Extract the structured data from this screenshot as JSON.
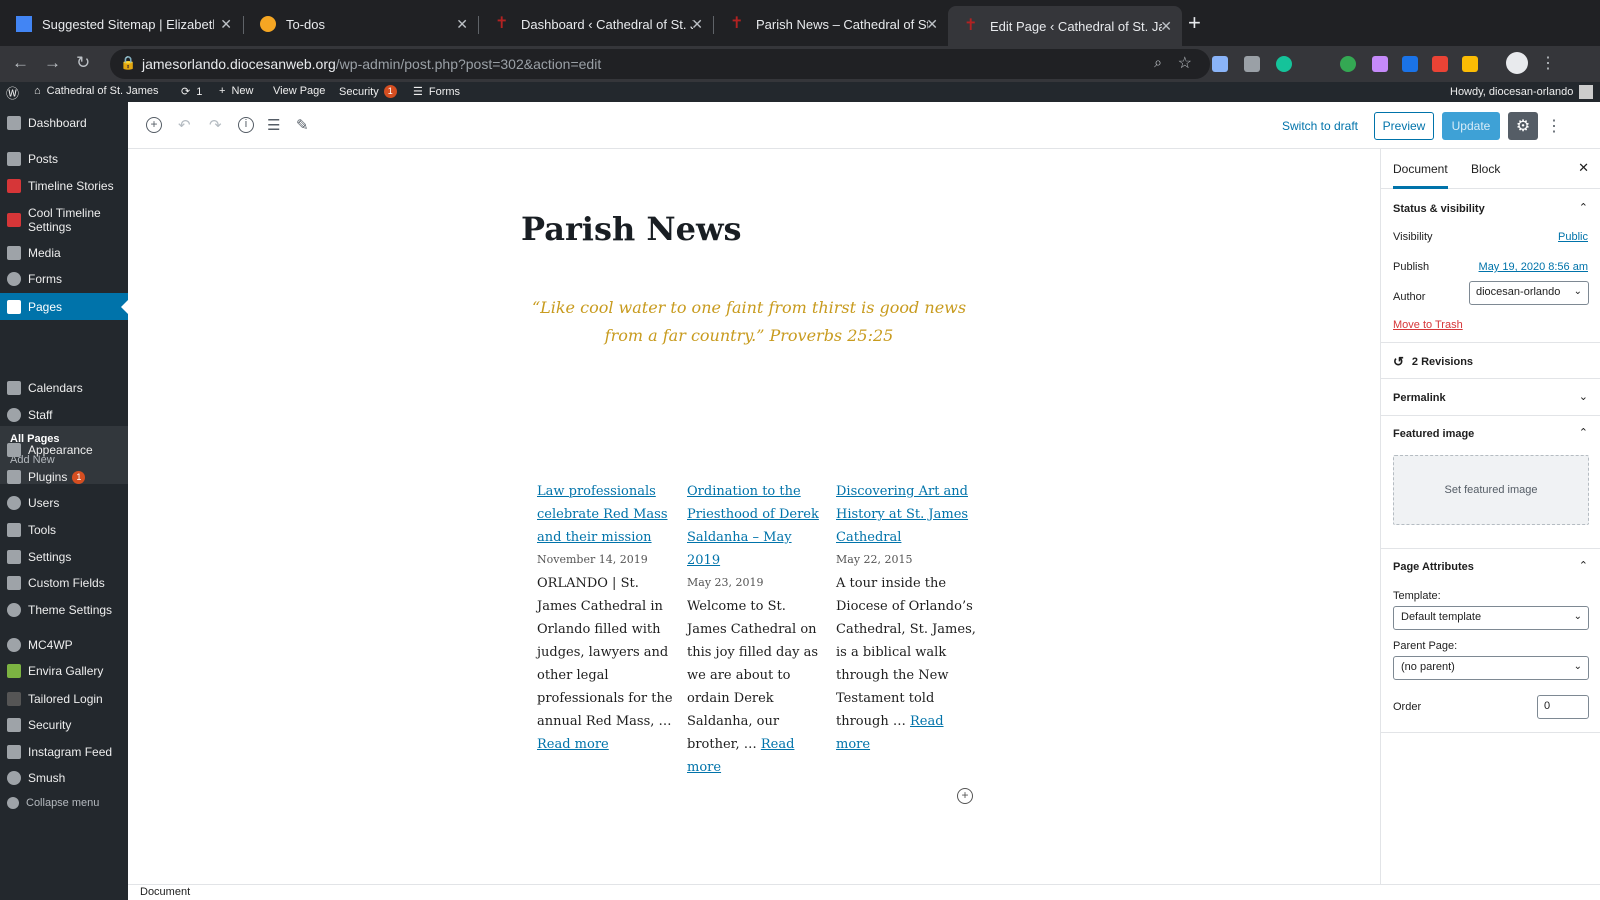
{
  "browser": {
    "tabs": [
      {
        "title": "Suggested Sitemap | Elizabeth",
        "favicon_color": "#4285f4"
      },
      {
        "title": "To-dos",
        "favicon_color": "#f5a623"
      },
      {
        "title": "Dashboard ‹ Cathedral of St. Ja",
        "favicon_color": "#b22222"
      },
      {
        "title": "Parish News – Cathedral of St.",
        "favicon_color": "#b22222"
      },
      {
        "title": "Edit Page ‹ Cathedral of St. Jar",
        "favicon_color": "#b22222"
      }
    ],
    "url_host": "jamesorlando.diocesanweb.org",
    "url_path": "/wp-admin/post.php?post=302&action=edit"
  },
  "adminbar": {
    "site": "Cathedral of St. James",
    "updates": "1",
    "new": "New",
    "view_page": "View Page",
    "security": "Security",
    "security_count": "1",
    "forms": "Forms",
    "howdy": "Howdy, diocesan-orlando"
  },
  "sidebar": {
    "items": [
      {
        "label": "Dashboard"
      },
      {
        "label": "Posts"
      },
      {
        "label": "Timeline Stories"
      },
      {
        "label": "Cool Timeline Settings"
      },
      {
        "label": "Media"
      },
      {
        "label": "Forms"
      },
      {
        "label": "Pages"
      },
      {
        "label": "Calendars"
      },
      {
        "label": "Staff"
      },
      {
        "label": "Appearance"
      },
      {
        "label": "Plugins"
      },
      {
        "label": "Users"
      },
      {
        "label": "Tools"
      },
      {
        "label": "Settings"
      },
      {
        "label": "Custom Fields"
      },
      {
        "label": "Theme Settings"
      },
      {
        "label": "MC4WP"
      },
      {
        "label": "Envira Gallery"
      },
      {
        "label": "Tailored Login"
      },
      {
        "label": "Security"
      },
      {
        "label": "Instagram Feed"
      },
      {
        "label": "Smush"
      },
      {
        "label": "Collapse menu"
      }
    ],
    "plugins_count": "1",
    "sub_all_pages": "All Pages",
    "sub_add_new": "Add New"
  },
  "editor": {
    "switch_to_draft": "Switch to draft",
    "preview": "Preview",
    "update": "Update",
    "title": "Parish News",
    "quote": "“Like cool water to one faint from thirst is good news from a far country.” Proverbs 25:25",
    "posts": [
      {
        "title": "Law professionals celebrate Red Mass and their mission",
        "date": "November 14, 2019",
        "excerpt": "ORLANDO | St. James Cathedral in Orlando filled with judges, lawyers and other legal professionals for the annual Red Mass, …",
        "read_more": "Read more"
      },
      {
        "title": "Ordination to the Priesthood of Derek Saldanha – May 2019",
        "date": "May 23, 2019",
        "excerpt": "Welcome to St. James Cathedral on this joy filled day as we are about to ordain Derek Saldanha, our brother, …",
        "read_more": "Read more"
      },
      {
        "title": "Discovering Art and History at St. James Cathedral",
        "date": "May 22, 2015",
        "excerpt": "A tour inside the Diocese of Orlando’s Cathedral, St. James, is a biblical walk through the New Testament told through …",
        "read_more": "Read more"
      }
    ],
    "footer": "Document"
  },
  "panel": {
    "tab_document": "Document",
    "tab_block": "Block",
    "status_visibility": "Status & visibility",
    "visibility_label": "Visibility",
    "visibility_value": "Public",
    "publish_label": "Publish",
    "publish_value": "May 19, 2020 8:56 am",
    "author_label": "Author",
    "author_value": "diocesan-orlando",
    "move_to_trash": "Move to Trash",
    "revisions": "2 Revisions",
    "permalink": "Permalink",
    "featured_image": "Featured image",
    "set_featured_image": "Set featured image",
    "page_attributes": "Page Attributes",
    "template_label": "Template:",
    "template_value": "Default template",
    "parent_label": "Parent Page:",
    "parent_value": "(no parent)",
    "order_label": "Order",
    "order_value": "0"
  }
}
